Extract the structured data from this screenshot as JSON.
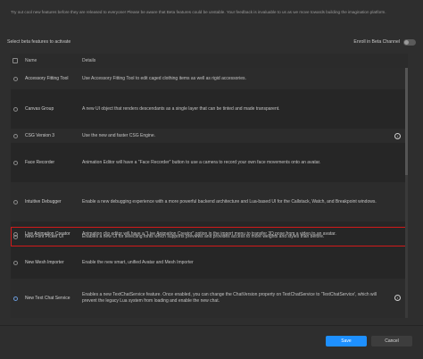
{
  "intro_text": "Try out cool new features before they are released to everyone! Please be aware that Beta features could be unstable. Your feedback is invaluable to us as we move towards building the imagination platform.",
  "section_label": "Select beta features to activate",
  "enroll_label": "Enroll in Beta Channel",
  "table": {
    "headers": {
      "name": "Name",
      "details": "Details"
    },
    "rows": [
      {
        "name": "Accessory Fitting Tool",
        "details": "Use Accessory Fitting Tool to edit caged clothing items as well as rigid accessories."
      },
      {
        "name": "Canvas Group",
        "details": "A new UI object that renders descendants as a single layer that can be tinted and made transparent."
      },
      {
        "name": "CSG Version 3",
        "details": "Use the new and faster CSG Engine."
      },
      {
        "name": "Face Recorder",
        "details": "Animation Editor will have a \"Face Recorder\" button to use a camera to record your own face movements onto an avatar."
      },
      {
        "name": "Intuitive Debugger",
        "details": "Enable a new debugging experience with a more powerful backend architecture and Lua-based UI for the Callstack, Watch, and Breakpoint windows."
      },
      {
        "name": "Live Animation Creator",
        "details": "Animation clip editor will have a \"Live Animation Creator\" option in the import menu to transfer 3D pose from a video to an avatar."
      },
      {
        "name": "New Font Picker UI",
        "details": "Enables a new UI for selecting fonts which supports previews and provides access to more weights and styles than before."
      },
      {
        "name": "New Mesh Importer",
        "details": "Enable the new smart, unified Avatar and Mesh Importer"
      },
      {
        "name": "New Text Chat Service",
        "details": "Enables a new TextChatService feature. Once enabled, you can change the ChatVersion property on TextChatService to 'TextChatService', which will prevent the legacy Lua system from loading and enable the new chat."
      }
    ]
  },
  "buttons": {
    "save": "Save",
    "cancel": "Cancel"
  },
  "info_glyph": "i",
  "colors": {
    "accent": "#1e90ff",
    "highlight": "#d11a1a"
  }
}
